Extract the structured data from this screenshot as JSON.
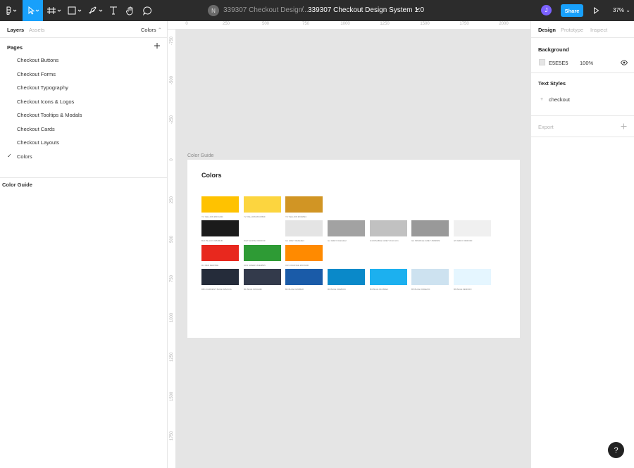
{
  "toolbar": {
    "team_initial": "N",
    "team_file": "339307 Checkout Design...",
    "separator": "/",
    "file_name": "339307 Checkout Design System 1.0",
    "user_initial": "J",
    "share_label": "Share",
    "zoom": "37%",
    "tools": [
      {
        "icon": "figma-menu-icon",
        "active": false
      },
      {
        "icon": "move-tool-icon",
        "active": true
      },
      {
        "icon": "frame-tool-icon",
        "active": false
      },
      {
        "icon": "rectangle-tool-icon",
        "active": false
      },
      {
        "icon": "pen-tool-icon",
        "active": false
      },
      {
        "icon": "text-tool-icon",
        "active": false
      },
      {
        "icon": "hand-tool-icon",
        "active": false
      },
      {
        "icon": "comment-tool-icon",
        "active": false
      }
    ]
  },
  "left_panel": {
    "tabs": {
      "layers": "Layers",
      "assets": "Assets"
    },
    "page_select": "Colors",
    "pages_title": "Pages",
    "pages": [
      {
        "label": "Checkout Buttons",
        "selected": false
      },
      {
        "label": "Checkout Forms",
        "selected": false
      },
      {
        "label": "Checkout Typography",
        "selected": false
      },
      {
        "label": "Checkout Icons & Logos",
        "selected": false
      },
      {
        "label": "Checkout Tooltips & Modals",
        "selected": false
      },
      {
        "label": "Checkout Cards",
        "selected": false
      },
      {
        "label": "Checkout Layouts",
        "selected": false
      },
      {
        "label": "Colors",
        "selected": true
      }
    ],
    "check_glyph": "✓",
    "layers": [
      {
        "label": "Color Guide"
      }
    ]
  },
  "rulers": {
    "top": [
      "0",
      "250",
      "500",
      "750",
      "1000",
      "1250",
      "1500",
      "1750",
      "2000"
    ],
    "left": [
      "-750",
      "-500",
      "-250",
      "0",
      "250",
      "500",
      "750",
      "1000",
      "1250",
      "1500",
      "1750"
    ]
  },
  "canvas": {
    "frame_label": "Color Guide",
    "frame_title": "Colors",
    "swatch_rows": [
      [
        {
          "color": "#ffc200",
          "caption": "Y1 YELLOW #FFC200"
        },
        {
          "color": "#fcd53f",
          "caption": "Y2 YELLOW #FCD53F"
        },
        {
          "color": "#d19524",
          "caption": "Y3 YELLOW #D19524"
        }
      ],
      [
        {
          "color": "#1b1b1b",
          "caption": "BLK BLACK #1B1B1B"
        },
        {
          "color": "#ffffff",
          "caption": "WHT WHITE #FFFFFF"
        },
        {
          "color": "#e4e4e4",
          "caption": "G1 GREY #E4E4E4"
        },
        {
          "color": "#a2a2a2",
          "caption": "G2 GREY #A2A2A2"
        },
        {
          "color": "#c1c1c1",
          "caption": "G3 DISABLE GREY #C1C1C1"
        },
        {
          "color": "#999999",
          "caption": "G4 SPARKLE GREY #999999"
        },
        {
          "color": "#f0f0f0",
          "caption": "G5 GREY #F0F0F0"
        }
      ],
      [
        {
          "color": "#e8281e",
          "caption": "R1 RED #E8281E"
        },
        {
          "color": "#2e9b35",
          "caption": "GR1 GREEN #2E9B35"
        },
        {
          "color": "#ff8a00",
          "caption": "OR1 ORANGE #FF8A00"
        }
      ],
      [
        {
          "color": "#252c3a",
          "caption": "DB1 DARKEST BLUE #252C3A"
        },
        {
          "color": "#333a4b",
          "caption": "B1 BLUE #333A4B"
        },
        {
          "color": "#1a5ba8",
          "caption": "B2 BLUE #1A5BA8"
        },
        {
          "color": "#0a89c9",
          "caption": "B3 BLUE #0A89C9"
        },
        {
          "color": "#1cb0ef",
          "caption": "B4 BLUE #1CB0EF"
        },
        {
          "color": "#cde2f0",
          "caption": "B5 BLUE #CDE2F0"
        },
        {
          "color": "#e5f6ff",
          "caption": "B6 BLUE #E5F6FF"
        }
      ]
    ]
  },
  "right_panel": {
    "tabs": {
      "design": "Design",
      "prototype": "Prototype",
      "inspect": "Inspect"
    },
    "background_title": "Background",
    "background_hex": "E5E5E5",
    "background_opacity": "100%",
    "text_styles_title": "Text Styles",
    "text_style": "checkout",
    "export_title": "Export"
  },
  "help_label": "?"
}
